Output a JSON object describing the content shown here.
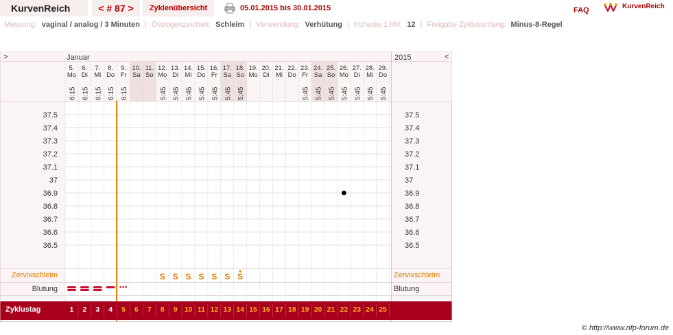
{
  "header": {
    "app_title": "KurvenReich",
    "cycle_nav": "< # 87 >",
    "overview_button": "Zyklenübersicht",
    "date_range": "05.01.2015 bis 30.01.2015",
    "faq": "FAQ",
    "logo_text": "KurvenReich"
  },
  "settings": [
    {
      "label": "Messung:",
      "value": "vaginal / analog / 3 Minuten"
    },
    {
      "label": "Östrogenzeichen:",
      "value": "Schleim"
    },
    {
      "label": "Verwendung:",
      "value": "Verhütung"
    },
    {
      "label": "früheste 1.hM:",
      "value": "12"
    },
    {
      "label": "Freigabe Zyklusanfang:",
      "value": "Minus-8-Regel"
    }
  ],
  "chart": {
    "nav_left": ">",
    "nav_right": "<",
    "month": "Januar",
    "year": "2015",
    "days": [
      {
        "d": "5.",
        "w": "Mo",
        "t": "6:15",
        "we": false
      },
      {
        "d": "6.",
        "w": "Di",
        "t": "6:15",
        "we": false
      },
      {
        "d": "7.",
        "w": "Mi",
        "t": "6:15",
        "we": false
      },
      {
        "d": "8.",
        "w": "Do",
        "t": "6:15",
        "we": false
      },
      {
        "d": "9.",
        "w": "Fr",
        "t": "6:15",
        "we": false
      },
      {
        "d": "10.",
        "w": "Sa",
        "t": "",
        "we": true
      },
      {
        "d": "11.",
        "w": "So",
        "t": "",
        "we": true
      },
      {
        "d": "12.",
        "w": "Mo",
        "t": "5:45",
        "we": false
      },
      {
        "d": "13.",
        "w": "Di",
        "t": "5:45",
        "we": false
      },
      {
        "d": "14.",
        "w": "Mi",
        "t": "5:45",
        "we": false
      },
      {
        "d": "15.",
        "w": "Do",
        "t": "5:45",
        "we": false
      },
      {
        "d": "16.",
        "w": "Fr",
        "t": "5:45",
        "we": false
      },
      {
        "d": "17.",
        "w": "Sa",
        "t": "5:45",
        "we": true
      },
      {
        "d": "18.",
        "w": "So",
        "t": "5:45",
        "we": true
      },
      {
        "d": "19.",
        "w": "Mo",
        "t": "",
        "we": false
      },
      {
        "d": "20.",
        "w": "Di",
        "t": "",
        "we": false
      },
      {
        "d": "21.",
        "w": "Mi",
        "t": "",
        "we": false
      },
      {
        "d": "22.",
        "w": "Do",
        "t": "",
        "we": false
      },
      {
        "d": "23.",
        "w": "Fr",
        "t": "5:45",
        "we": false
      },
      {
        "d": "24.",
        "w": "Sa",
        "t": "5:45",
        "we": true
      },
      {
        "d": "25.",
        "w": "So",
        "t": "5:45",
        "we": true
      },
      {
        "d": "26.",
        "w": "Mo",
        "t": "5:45",
        "we": false
      },
      {
        "d": "27.",
        "w": "Di",
        "t": "5:45",
        "we": false
      },
      {
        "d": "28.",
        "w": "Mi",
        "t": "5:45",
        "we": false
      },
      {
        "d": "29.",
        "w": "Do",
        "t": "5:45",
        "we": false
      }
    ],
    "temps": [
      "37.5",
      "37.4",
      "37.3",
      "37.2",
      "37.1",
      "37",
      "36.9",
      "36.8",
      "36.7",
      "36.6",
      "36.5"
    ],
    "temperature_points": [
      {
        "day_index": 21,
        "value": 36.9
      }
    ],
    "cycle_start_marker_after_index": 3,
    "mucus_label": "Zervixschleim",
    "mucus": [
      "",
      "",
      "",
      "",
      "",
      "",
      "",
      "S",
      "S",
      "S",
      "S",
      "S",
      "S",
      "S",
      "",
      "",
      "",
      "",
      "",
      "",
      "",
      "",
      "",
      "",
      ""
    ],
    "mucus_peak_index": 13,
    "mucus_peak_mark": "+",
    "bleeding_label": "Blutung",
    "bleeding": [
      "heavy",
      "heavy",
      "heavy",
      "medium",
      "spotting",
      "",
      "",
      "",
      "",
      "",
      "",
      "",
      "",
      "",
      "",
      "",
      "",
      "",
      "",
      "",
      "",
      "",
      "",
      "",
      ""
    ],
    "cycle_day_label": "Zyklustag",
    "cycle_days": [
      "1",
      "2",
      "3",
      "4",
      "5",
      "6",
      "7",
      "8",
      "9",
      "10",
      "11",
      "12",
      "13",
      "14",
      "15",
      "16",
      "17",
      "18",
      "19",
      "20",
      "21",
      "22",
      "23",
      "24",
      "25"
    ],
    "colors": {
      "accent": "#e07b00",
      "brand": "#a8001c",
      "weekend": "#efe0e0",
      "grid": "#d9d9d9"
    }
  },
  "copyright": "© http://www.nfp-forum.de"
}
